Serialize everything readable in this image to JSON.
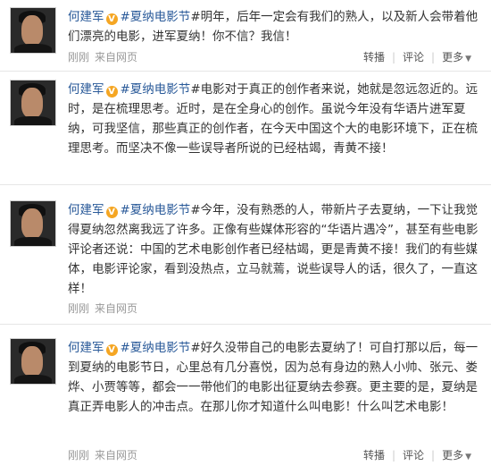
{
  "posts": [
    {
      "author": "何建军",
      "topic": "#夏纳电影节",
      "text": "#明年，后年一定会有我们的熟人，以及新人会带着他们漂亮的电影，进军夏纳！你不信？我信！",
      "time": "刚刚",
      "source": "来自网页"
    },
    {
      "author": "何建军",
      "topic": "#夏纳电影节",
      "text": "#电影对于真正的创作者来说，她就是忽远忽近的。远时，是在梳理思考。近时，是在全身心的创作。虽说今年没有华语片进军夏纳，可我坚信，那些真正的创作者，在今天中国这个大的电影环境下，正在梳理思考。而坚决不像一些误导者所说的已经枯竭，青黄不接！",
      "time": "",
      "source": ""
    },
    {
      "author": "何建军",
      "topic": "#夏纳电影节",
      "text": "#今年，没有熟悉的人，带新片子去夏纳，一下让我觉得夏纳忽然离我远了许多。正像有些媒体形容的“华语片遇冷”，甚至有些电影评论者还说：中国的艺术电影创作者已经枯竭，更是青黄不接！我们的有些媒体，电影评论家，看到没热点，立马就蔫，说些误导人的话，很久了，一直这样！",
      "time": "刚刚",
      "source": "来自网页"
    },
    {
      "author": "何建军",
      "topic": "#夏纳电影节",
      "text": "#好久没带自己的电影去夏纳了！可自打那以后，每一到夏纳的电影节日，心里总有几分喜悦，因为总有身边的熟人小帅、张元、娄烨、小贾等等，都会一一带他们的电影出征夏纳去参赛。更主要的是，夏纳是真正弄电影人的冲击点。在那儿你才知道什么叫电影！什么叫艺术电影！",
      "time": "刚刚",
      "source": "来自网页"
    }
  ],
  "actions": {
    "repost": "转播",
    "comment": "评论",
    "more": "更多"
  },
  "colors": {
    "link": "#2a5a99",
    "meta": "#999999",
    "badge": "#f5a623"
  }
}
